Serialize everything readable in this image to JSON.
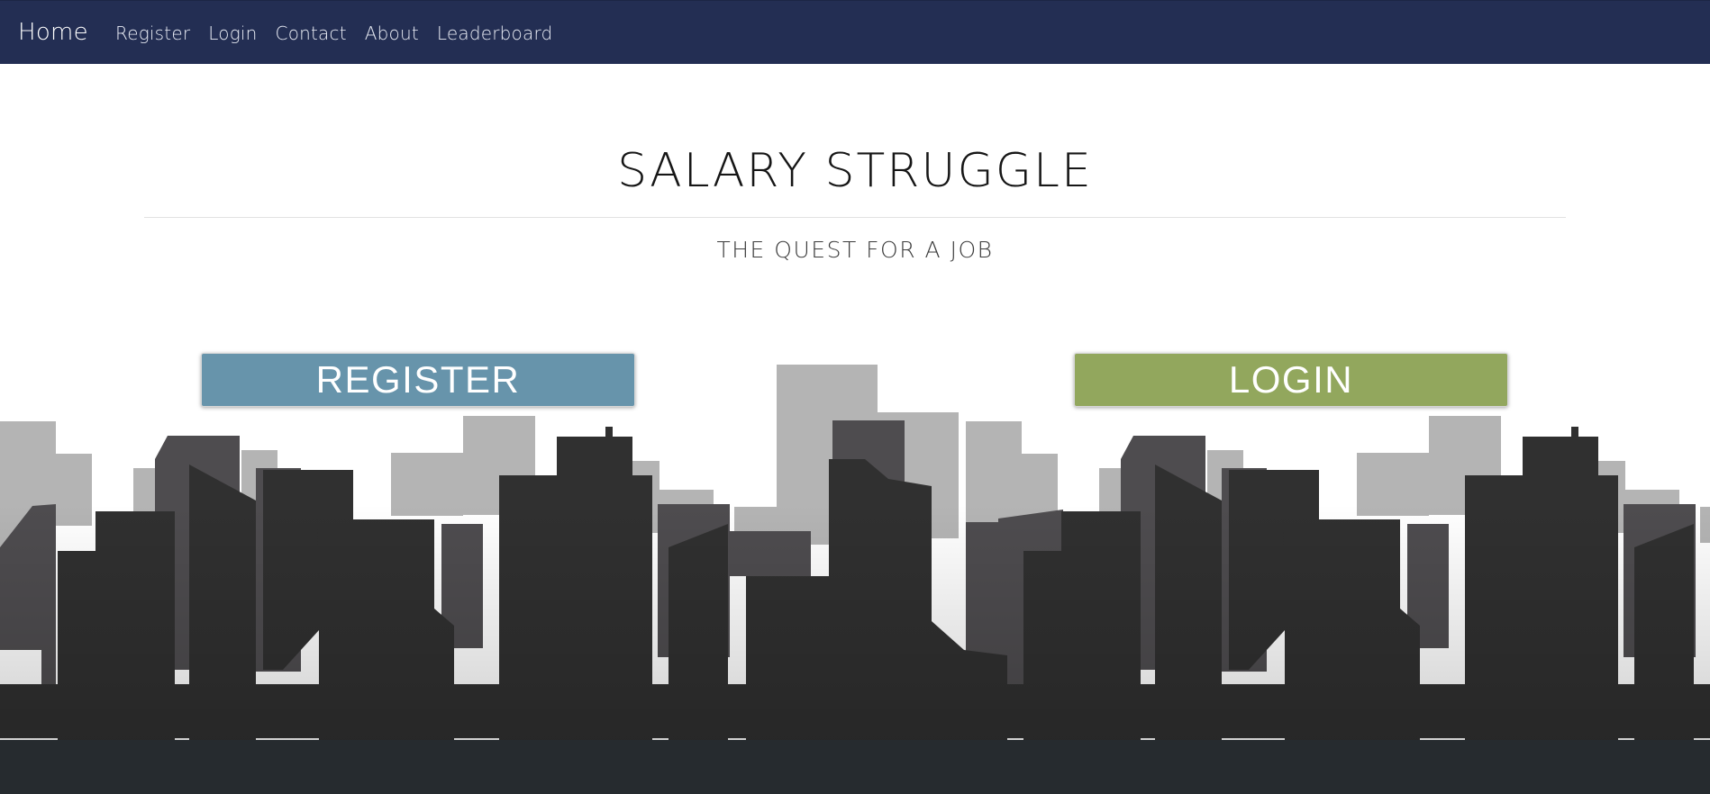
{
  "nav": {
    "brand": "Home",
    "links": [
      "Register",
      "Login",
      "Contact",
      "About",
      "Leaderboard"
    ]
  },
  "hero": {
    "title": "SALARY STRUGGLE",
    "subtitle": "THE QUEST FOR A JOB"
  },
  "actions": {
    "register_label": "REGISTER",
    "login_label": "LOGIN"
  },
  "colors": {
    "navbar": "#232e53",
    "register_button": "#6794ab",
    "login_button": "#92a75d",
    "skyline_back": "#b4b4b4",
    "skyline_mid": "#4e4c4f",
    "skyline_front": "#303030",
    "ground": "#262b2f"
  }
}
